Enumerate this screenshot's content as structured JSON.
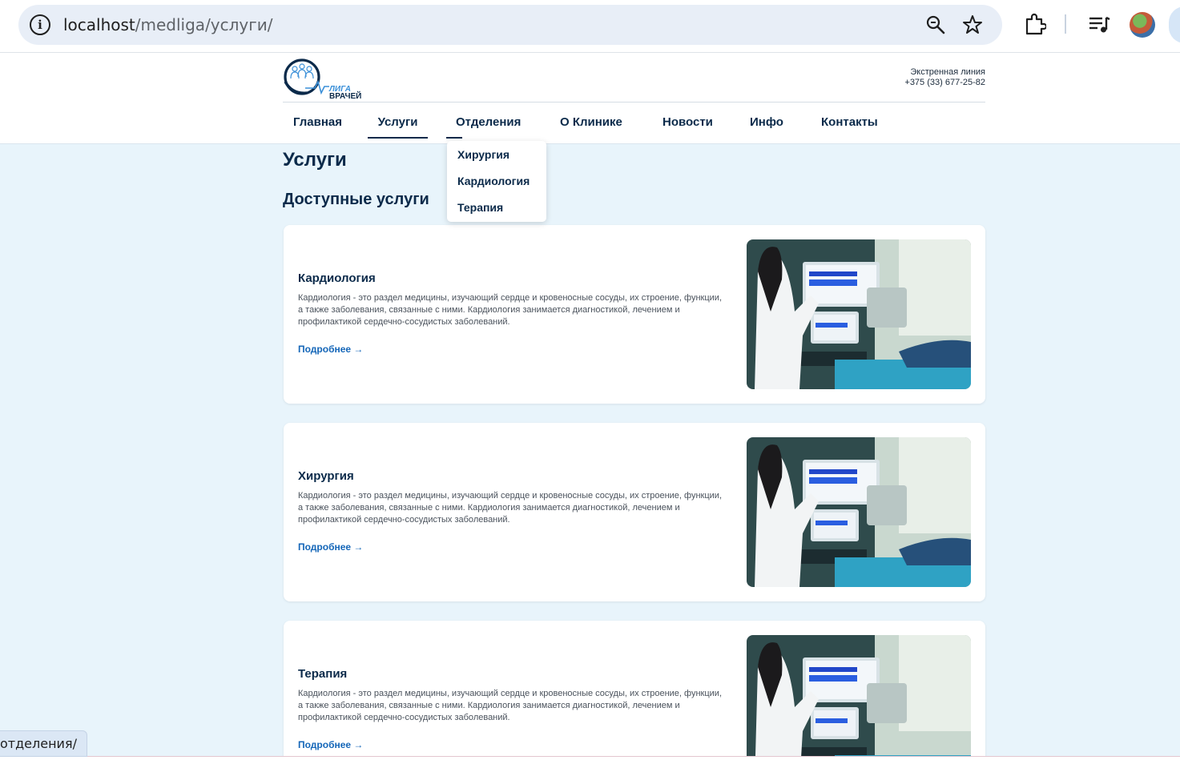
{
  "browser": {
    "url_host": "localhost",
    "url_path": "/medliga/услуги/",
    "icons": [
      "info-icon",
      "zoom-icon",
      "bookmark-star-icon",
      "extensions-icon",
      "media-controls-icon",
      "profile-avatar"
    ]
  },
  "site": {
    "logo_text_line1": "ЛИГА",
    "logo_text_line2": "ВРАЧЕЙ",
    "hotline_label": "Экстренная линия",
    "hotline_phone": "+375 (33) 677-25-82",
    "nav": [
      {
        "label": "Главная",
        "state": "default"
      },
      {
        "label": "Услуги",
        "state": "active"
      },
      {
        "label": "Отделения",
        "state": "open"
      },
      {
        "label": "О Клинике",
        "state": "default"
      },
      {
        "label": "Новости",
        "state": "default"
      },
      {
        "label": "Инфо",
        "state": "default"
      },
      {
        "label": "Контакты",
        "state": "default"
      }
    ],
    "dropdown": [
      "Хирургия",
      "Кардиология",
      "Терапия"
    ]
  },
  "page": {
    "title": "Услуги",
    "section_title": "Доступные услуги",
    "cards": [
      {
        "title": "Кардиология",
        "text": "Кардиология - это раздел медицины, изучающий сердце и кровеносные сосуды, их строение, функции, а также заболевания, связанные с ними. Кардиология занимается диагностикой, лечением и профилактикой сердечно-сосудистых заболеваний.",
        "link": "Подробнее →"
      },
      {
        "title": "Хирургия",
        "text": "Кардиология - это раздел медицины, изучающий сердце и кровеносные сосуды, их строение, функции, а также заболевания, связанные с ними. Кардиология занимается диагностикой, лечением и профилактикой сердечно-сосудистых заболеваний.",
        "link": "Подробнее →"
      },
      {
        "title": "Терапия",
        "text": "Кардиология - это раздел медицины, изучающий сердце и кровеносные сосуды, их строение, функции, а также заболевания, связанные с ними. Кардиология занимается диагностикой, лечением и профилактикой сердечно-сосудистых заболеваний.",
        "link": "Подробнее →"
      }
    ]
  },
  "status_bar": {
    "text": "отделения/"
  },
  "colors": {
    "brand_dark": "#0b2a4a",
    "link_blue": "#1466b8",
    "page_bg": "#e8f4fb"
  }
}
